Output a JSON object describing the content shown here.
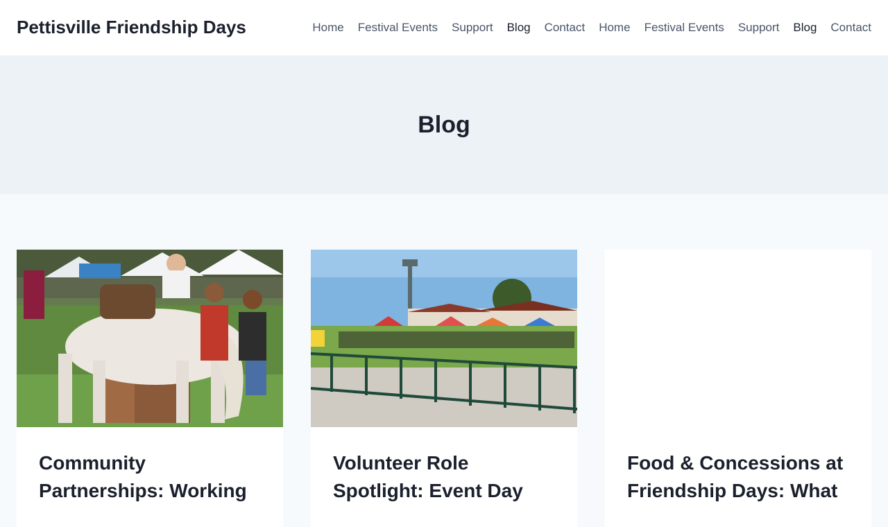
{
  "site": {
    "title": "Pettisville Friendship Days"
  },
  "nav": {
    "items": [
      {
        "label": "Home"
      },
      {
        "label": "Festival Events"
      },
      {
        "label": "Support"
      },
      {
        "label": "Blog",
        "active": true
      },
      {
        "label": "Contact"
      },
      {
        "label": "Home"
      },
      {
        "label": "Festival Events"
      },
      {
        "label": "Support"
      },
      {
        "label": "Blog",
        "active": true
      },
      {
        "label": "Contact"
      }
    ]
  },
  "hero": {
    "title": "Blog"
  },
  "posts": [
    {
      "title": "Community Partnerships: Working",
      "image": "horse-at-fair-photo"
    },
    {
      "title": "Volunteer Role Spotlight: Event Day",
      "image": "festival-field-tents-photo"
    },
    {
      "title": "Food & Concessions at Friendship Days: What",
      "image": ""
    }
  ],
  "colors": {
    "header_bg": "#ffffff",
    "hero_bg": "#edf2f7",
    "page_bg": "#f7fafc",
    "text": "#1a202c",
    "nav_text": "#4a5568"
  }
}
